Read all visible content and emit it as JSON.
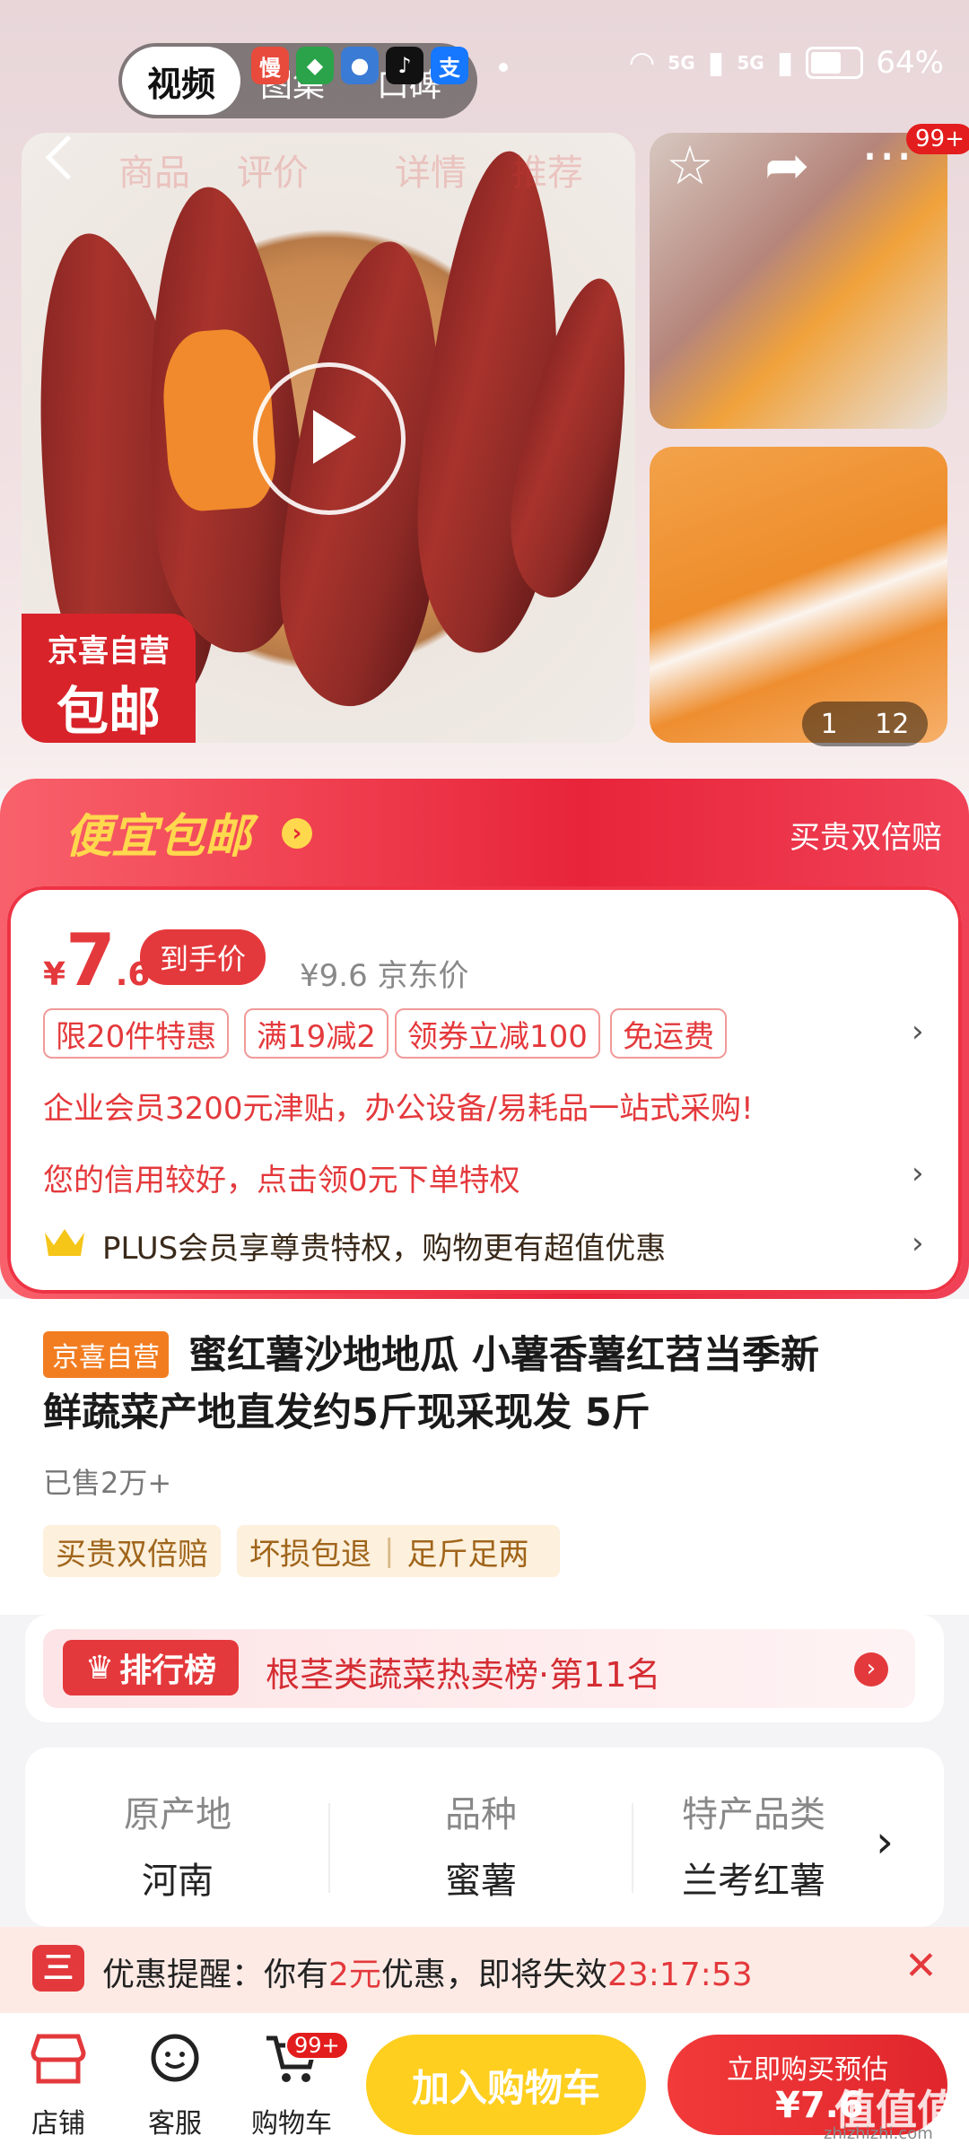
{
  "status": {
    "video_label": "视频",
    "tabs": [
      "图集",
      "口碑"
    ],
    "battery": "64%",
    "signal": [
      "5G",
      "5G"
    ]
  },
  "nav": {
    "items": [
      "商品",
      "评价",
      "详情",
      "推荐"
    ],
    "badge": "99+"
  },
  "media": {
    "badge_line1": "京喜自营",
    "badge_line2": "包邮",
    "counter_current": "1",
    "counter_total": "12"
  },
  "promo": {
    "title": "便宜包邮",
    "right_text": "买贵双倍赔",
    "price_symbol": "¥",
    "price_int": "7",
    "price_dec": ".6",
    "price_tag": "到手价",
    "jd_price": "¥9.6  京东价",
    "tags": [
      "限20件特惠",
      "满19减2",
      "领券立减100",
      "免运费"
    ],
    "line_enterprise": "企业会员3200元津贴，办公设备/易耗品一站式采购!",
    "line_credit": "您的信用较好，点击领0元下单特权",
    "line_plus": "PLUS会员享尊贵特权，购物更有超值优惠"
  },
  "product": {
    "self_tag": "京喜自营",
    "title_line1": "蜜红薯沙地地瓜 小薯香薯红苕当季新",
    "title_line2": "鲜蔬菜产地直发约5斤现采现发 5斤",
    "sold": "已售2万+",
    "services": [
      "买贵双倍赔",
      "坏损包退",
      "足斤足两"
    ]
  },
  "ranking": {
    "badge": "排行榜",
    "text": "根茎类蔬菜热卖榜·第11名"
  },
  "attributes": [
    {
      "key": "原产地",
      "value": "河南"
    },
    {
      "key": "品种",
      "value": "蜜薯"
    },
    {
      "key": "特产品类",
      "value": "兰考红薯"
    }
  ],
  "reminder": {
    "prefix": "优惠提醒：你有",
    "amount": "2元",
    "middle": "优惠，即将失效",
    "countdown": "23:17:53"
  },
  "bottom": {
    "shop": "店铺",
    "service": "客服",
    "cart": "购物车",
    "cart_badge": "99+",
    "add_cart": "加入购物车",
    "buy_now": "立即购买预估",
    "buy_price": "¥7.6"
  },
  "watermark": {
    "text": "值值值",
    "sub": "zhizhizhi.com"
  }
}
